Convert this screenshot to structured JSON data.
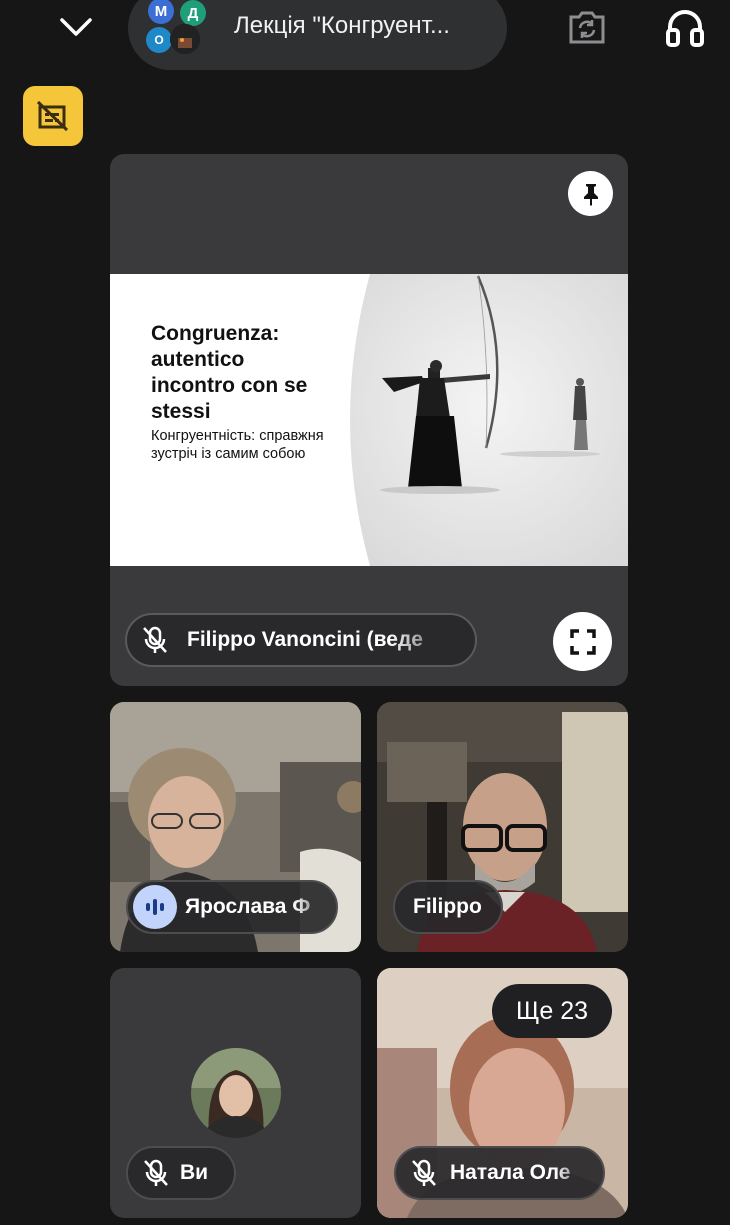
{
  "header": {
    "meeting_title": "Лекція \"Конгруент...",
    "avatars": [
      {
        "letter": "М",
        "color": "#3b6fd6"
      },
      {
        "letter": "Д",
        "color": "#1f9e7a"
      },
      {
        "letter": "О",
        "color": "#1e88c9"
      }
    ]
  },
  "slide": {
    "heading": "Congruenza: autentico incontro con se stessi",
    "subtitle": "Конгруентність: справжня зустріч із самим собою"
  },
  "participants": {
    "presenter": {
      "name": "Filippo Vanoncini (веде"
    },
    "tile_yaroslava": {
      "name": "Ярослава Ф"
    },
    "tile_filippo": {
      "name": "Filippo"
    },
    "tile_self": {
      "name": "Ви"
    },
    "tile_natalia": {
      "name": "Натала Оле"
    },
    "more_count": "Ще 23"
  },
  "colors": {
    "background": "#161617",
    "tile": "#3a3a3c",
    "no_captions_button": "#f5c53a",
    "speaking_badge": "#c2d4fb"
  }
}
